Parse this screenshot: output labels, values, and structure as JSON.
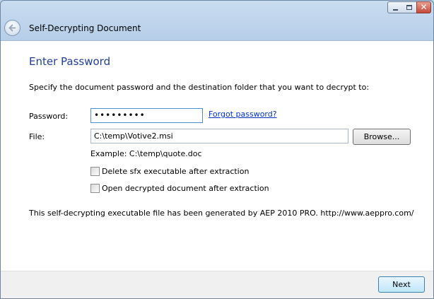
{
  "window": {
    "minimize_icon": "minimize-icon",
    "maximize_icon": "maximize-icon",
    "close_icon": "close-icon",
    "close_glyph": "✕"
  },
  "header": {
    "title": "Self-Decrypting Document",
    "back_icon": "back-arrow-icon"
  },
  "content": {
    "heading": "Enter Password",
    "intro": "Specify the document password and the destination folder that you want to decrypt to:",
    "password_label": "Password:",
    "password_value": "•••••••••",
    "forgot_link": "Forgot password?",
    "file_label": "File:",
    "file_value": "C:\\temp\\Votive2.msi",
    "browse_label": "Browse...",
    "example": "Example: C:\\temp\\quote.doc",
    "options": [
      {
        "label": "Delete sfx executable after extraction",
        "checked": false
      },
      {
        "label": "Open decrypted document after extraction",
        "checked": false
      }
    ],
    "footer_note": "This self-decrypting executable file has been generated by AEP 2010 PRO. http://www.aeppro.com/"
  },
  "bottom": {
    "next_label": "Next"
  },
  "colors": {
    "heading": "#1e3f9a",
    "link": "#0033cc",
    "frame": "#b5cde8"
  }
}
